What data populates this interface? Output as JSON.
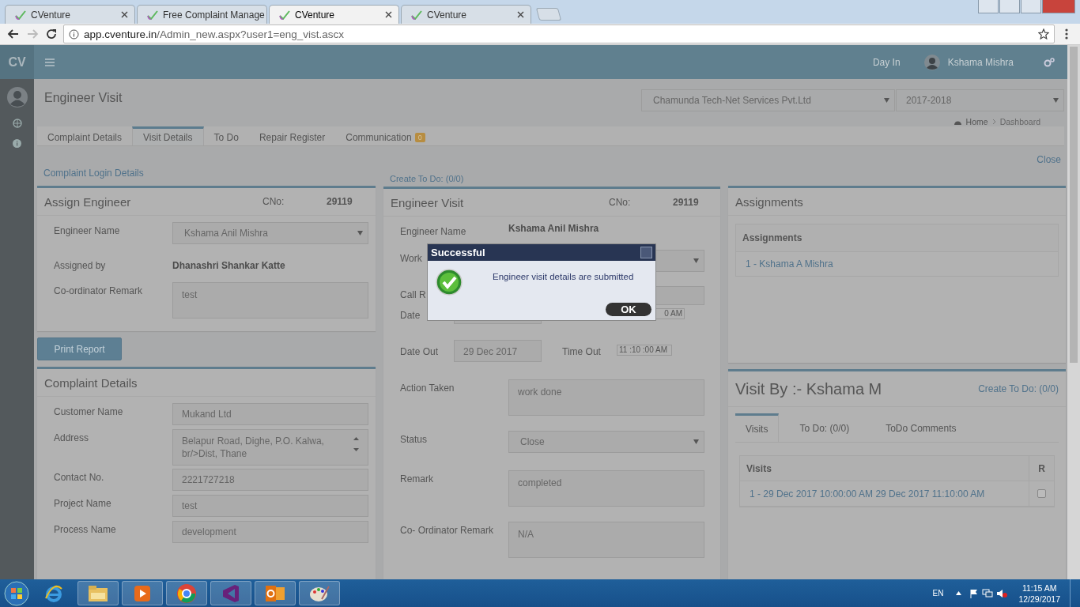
{
  "browser": {
    "tabs": [
      {
        "title": "CVenture",
        "selected": false
      },
      {
        "title": "Free Complaint Manage",
        "selected": false
      },
      {
        "title": "CVenture",
        "selected": true
      },
      {
        "title": "CVenture",
        "selected": false
      }
    ],
    "url_host": "app.cventure.in",
    "url_path": "/Admin_new.aspx?user1=eng_vist.ascx"
  },
  "header": {
    "logo": "CV",
    "day_in": "Day In",
    "user": "Kshama Mishra"
  },
  "page": {
    "title": "Engineer Visit",
    "company": "Chamunda Tech-Net Services Pvt.Ltd",
    "year": "2017-2018",
    "breadcrumb": [
      "Home",
      "Dashboard"
    ]
  },
  "tabs": [
    {
      "label": "Complaint Details",
      "selected": false
    },
    {
      "label": "Visit Details",
      "selected": true
    },
    {
      "label": "To Do",
      "selected": false
    },
    {
      "label": "Repair Register",
      "selected": false
    },
    {
      "label": "Communication",
      "badge": "0",
      "selected": false
    }
  ],
  "complaint_login_link": "Complaint Login Details",
  "close_link": "Close",
  "create_todo_link": "Create To Do: (0/0)",
  "assign_engineer": {
    "title": "Assign Engineer",
    "cno_label": "CNo:",
    "cno": "29119",
    "fields": [
      {
        "kind": "select",
        "label": "Engineer Name",
        "value": "Kshama Anil Mishra"
      },
      {
        "kind": "text",
        "label": "Assigned by",
        "value": "Dhanashri Shankar Katte"
      },
      {
        "kind": "textarea",
        "label": "Co-ordinator Remark",
        "value": "test"
      }
    ]
  },
  "print_button": "Print Report",
  "complaint_details": {
    "title": "Complaint Details",
    "fields": [
      {
        "kind": "input",
        "label": "Customer Name",
        "value": "Mukand Ltd"
      },
      {
        "kind": "address",
        "label": "Address",
        "value": "Belapur Road, Dighe, P.O. Kalwa, br/>Dist, Thane"
      },
      {
        "kind": "input",
        "label": "Contact No.",
        "value": "2221727218"
      },
      {
        "kind": "input",
        "label": "Project Name",
        "value": "test"
      },
      {
        "kind": "input",
        "label": "Process Name",
        "value": "development"
      }
    ]
  },
  "engineer_visit": {
    "title": "Engineer Visit",
    "cno_label": "CNo:",
    "cno": "29119",
    "fields": [
      {
        "kind": "text",
        "label": "Engineer Name",
        "value": "Kshama Anil Mishra"
      },
      {
        "kind": "select",
        "label": "Work"
      },
      {
        "kind": "input",
        "label": "Call R"
      },
      {
        "kind": "datetime",
        "label": "Date",
        "time": "0 AM"
      },
      {
        "kind": "datetime",
        "label": "Date Out",
        "value": "29 Dec 2017",
        "time_label": "Time Out",
        "time": "11 :10 :00 AM"
      },
      {
        "kind": "textarea",
        "label": "Action Taken",
        "value": "work done"
      },
      {
        "kind": "select",
        "label": "Status",
        "value": "Close"
      },
      {
        "kind": "textarea",
        "label": "Remark",
        "value": "completed"
      },
      {
        "kind": "textarea",
        "label": "Co- Ordinator Remark",
        "value": "N/A"
      }
    ]
  },
  "assignments": {
    "title": "Assignments",
    "table_heading": "Assignments",
    "rows": [
      "1 - Kshama A Mishra"
    ]
  },
  "visit_by": {
    "title": "Visit By :- Kshama M",
    "create_todo_link": "Create To Do: (0/0)",
    "tabs": [
      {
        "label": "Visits",
        "selected": true
      },
      {
        "label": "To Do: (0/0)",
        "selected": false
      },
      {
        "label": "ToDo Comments",
        "selected": false
      }
    ],
    "columns": [
      "Visits",
      "R"
    ],
    "rows": [
      {
        "text": "1 - 29 Dec 2017 10:00:00 AM 29 Dec 2017 11:10:00 AM",
        "checked": false
      }
    ]
  },
  "dialog": {
    "title": "Successful",
    "message": "Engineer visit details are submitted",
    "ok": "OK"
  },
  "taskbar": {
    "language": "EN",
    "time": "11:15 AM",
    "date": "12/29/2017"
  }
}
